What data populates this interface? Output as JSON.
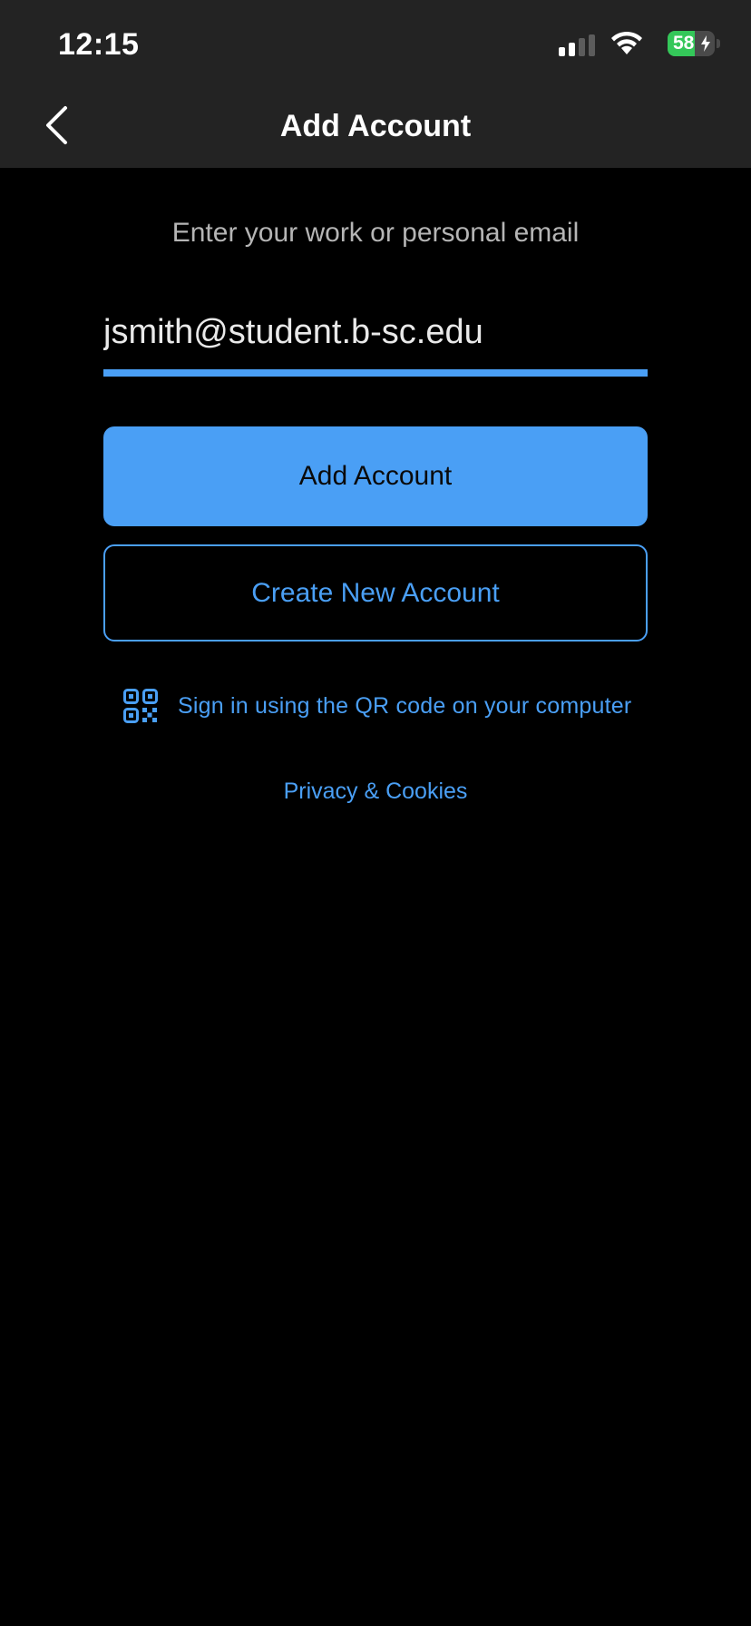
{
  "status_bar": {
    "time": "12:15",
    "battery_level": "58",
    "battery_percent": 58,
    "icons": [
      "signal-icon",
      "wifi-icon",
      "battery-icon",
      "charging-bolt-icon"
    ]
  },
  "nav": {
    "title": "Add Account",
    "back_icon": "chevron-left-icon"
  },
  "form": {
    "prompt": "Enter your work or personal email",
    "email_value": "jsmith@student.b-sc.edu"
  },
  "actions": {
    "add_account_label": "Add Account",
    "create_account_label": "Create New Account",
    "qr_icon": "qr-code-icon",
    "qr_signin_label": "Sign in using the QR code on your computer",
    "privacy_label": "Privacy & Cookies"
  },
  "colors": {
    "accent": "#4a9ff5",
    "background": "#000000",
    "bar_background": "#232323",
    "battery_green": "#34c759"
  }
}
